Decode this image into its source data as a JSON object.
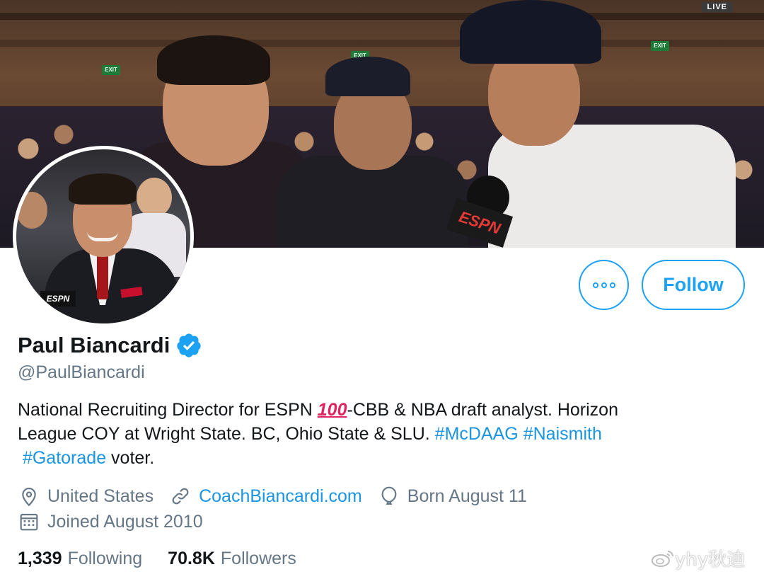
{
  "banner": {
    "live_badge": "LIVE",
    "exit_sign": "EXIT",
    "mic_flag": "ESPN"
  },
  "avatar": {
    "espn_badge": "ESPN"
  },
  "actions": {
    "follow_label": "Follow"
  },
  "profile": {
    "display_name": "Paul Biancardi",
    "verified": true,
    "handle": "@PaulBiancardi",
    "bio": {
      "line1_a": "National Recruiting Director for ESPN ",
      "emoji": "100",
      "line1_b": "-CBB & NBA draft analyst. Horizon",
      "line2": "League COY at Wright State. BC, Ohio State & SLU. ",
      "hashtag1": "#McDAAG",
      "hashtag2": "#Naismith",
      "hashtag3": "#Gatorade",
      "line3_tail": " voter."
    },
    "location": "United States",
    "website": "CoachBiancardi.com",
    "birthday": "Born August 11",
    "joined": "Joined August 2010",
    "icons": {
      "location": "location-pin-icon",
      "website": "link-icon",
      "birthday": "balloon-icon",
      "joined": "calendar-icon",
      "verified": "verified-badge-icon",
      "more": "more-dots-icon"
    }
  },
  "stats": {
    "following_count": "1,339",
    "following_label": "Following",
    "followers_count": "70.8K",
    "followers_label": "Followers"
  },
  "watermark": {
    "text": "yhy秋迪"
  },
  "colors": {
    "accent": "#1da1f2",
    "link": "#1b95e0",
    "secondary_text": "#657786",
    "primary_text": "#14171a"
  }
}
